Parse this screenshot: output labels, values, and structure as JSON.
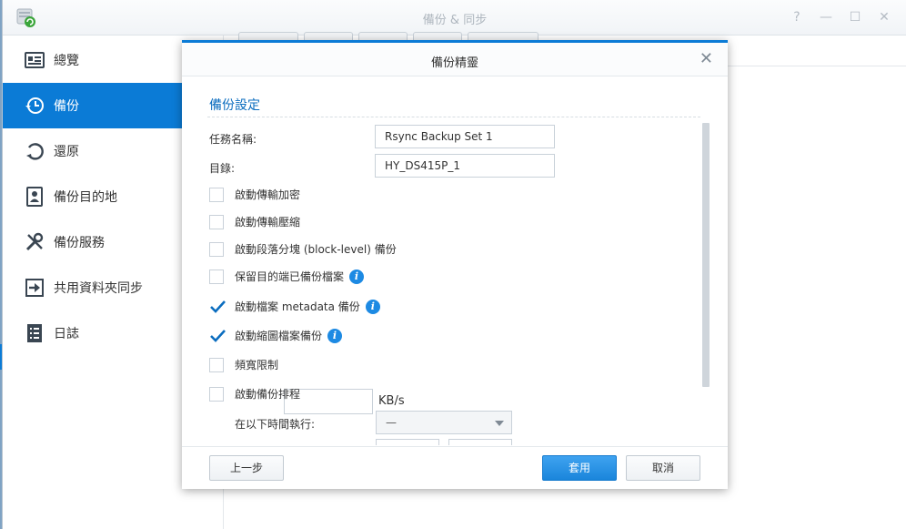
{
  "app": {
    "title": "備份 & 同步",
    "window_buttons": [
      "?",
      "—",
      "☐",
      "✕"
    ]
  },
  "sidebar": {
    "items": [
      {
        "label": "總覽",
        "icon": "overview-icon",
        "active": false
      },
      {
        "label": "備份",
        "icon": "backup-clock-icon",
        "active": true
      },
      {
        "label": "還原",
        "icon": "restore-icon",
        "active": false
      },
      {
        "label": "備份目的地",
        "icon": "destination-icon",
        "active": false
      },
      {
        "label": "備份服務",
        "icon": "tools-icon",
        "active": false
      },
      {
        "label": "共用資料夾同步",
        "icon": "sync-icon",
        "active": false
      },
      {
        "label": "日誌",
        "icon": "log-icon",
        "active": false
      }
    ]
  },
  "dialog": {
    "title": "備份精靈",
    "section_title": "備份設定",
    "task_name_label": "任務名稱:",
    "task_name_value": "Rsync Backup Set 1",
    "destination_label": "目錄:",
    "destination_value": "HY_DS415P_1",
    "options": [
      {
        "label": "啟動傳輸加密",
        "checked": false,
        "info": false
      },
      {
        "label": "啟動傳輸壓縮",
        "checked": false,
        "info": false
      },
      {
        "label": "啟動段落分塊 (block-level) 備份",
        "checked": false,
        "info": false
      },
      {
        "label": "保留目的端已備份檔案",
        "checked": false,
        "info": true
      },
      {
        "label": "啟動檔案 metadata 備份",
        "checked": true,
        "info": true
      },
      {
        "label": "啟動縮圖檔案備份",
        "checked": true,
        "info": true
      }
    ],
    "bandwidth_label": "頻寬限制",
    "bandwidth_value": "",
    "bandwidth_unit": "KB/s",
    "schedule_label": "啟動備份排程",
    "schedule_checked": false,
    "run_time_label": "在以下時間執行:",
    "run_time_value": "—",
    "info_glyph": "i",
    "buttons": {
      "back": "上一步",
      "apply": "套用",
      "cancel": "取消"
    },
    "close_glyph": "✕"
  },
  "colors": {
    "accent": "#0b7bd6",
    "section_title": "#0b6dbf",
    "info": "#1d8ae3"
  }
}
